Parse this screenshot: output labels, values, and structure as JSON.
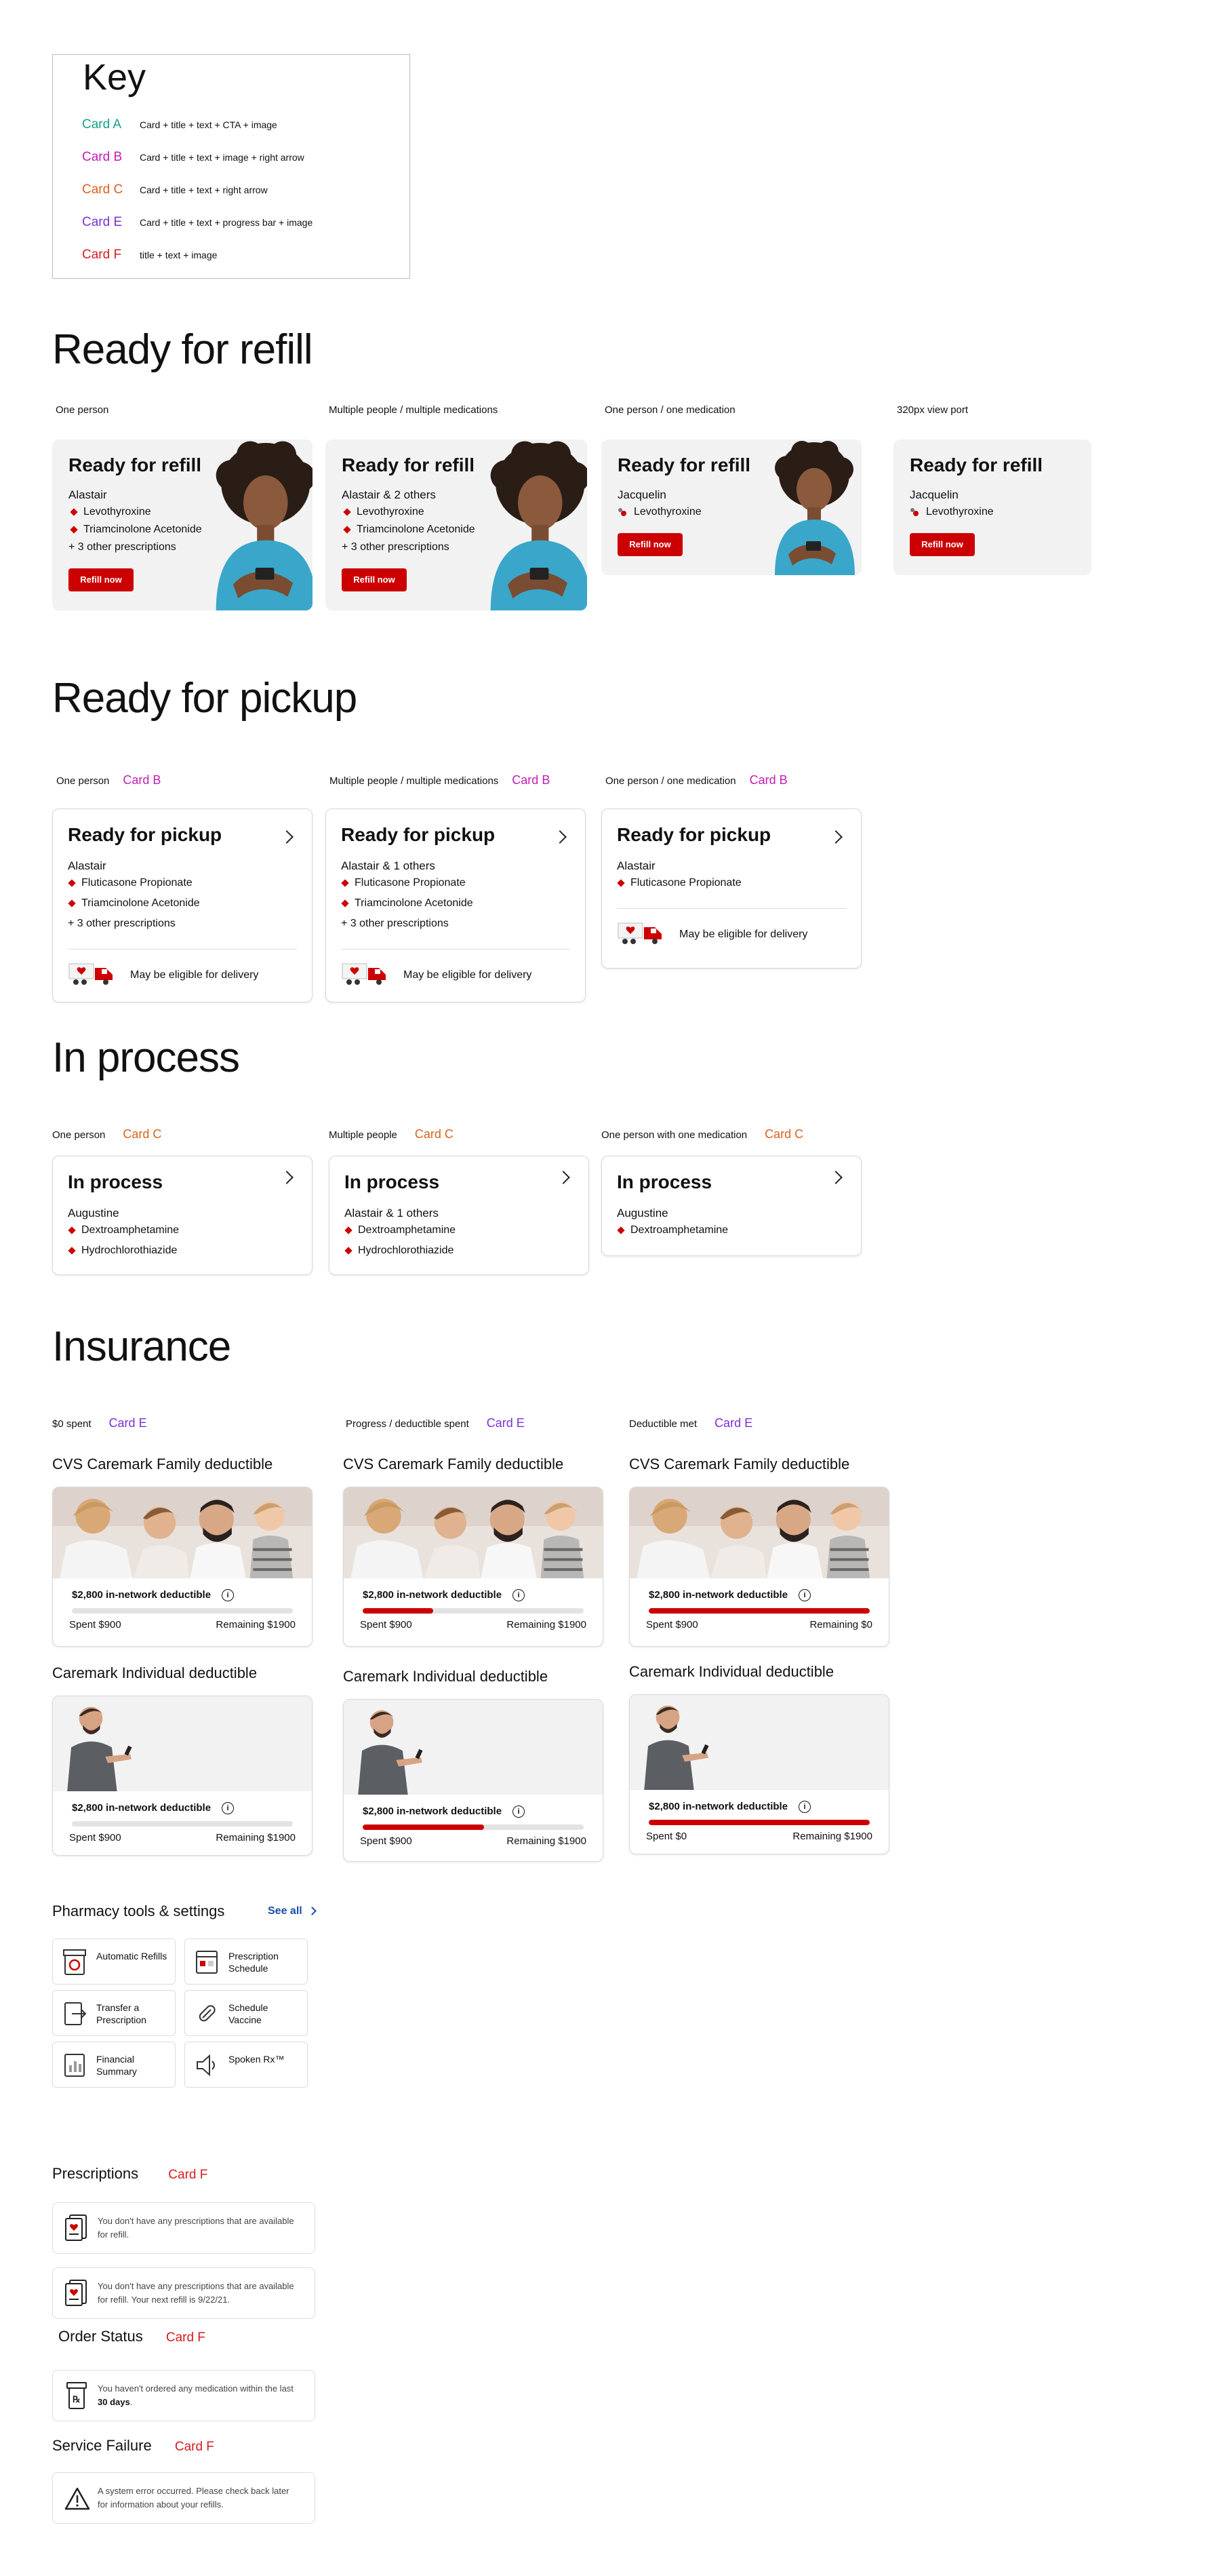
{
  "key": {
    "title": "Key",
    "items": [
      {
        "label": "Card A",
        "desc": "Card + title + text + CTA + image",
        "color": "#14a38b"
      },
      {
        "label": "Card B",
        "desc": "Card + title + text  + image + right arrow",
        "color": "#c21db5"
      },
      {
        "label": "Card C",
        "desc": "Card + title + text + right arrow",
        "color": "#d9621d"
      },
      {
        "label": "Card E",
        "desc": "Card + title + text  + progress bar + image",
        "color": "#7a30d6"
      },
      {
        "label": "Card F",
        "desc": "title + text  +  image",
        "color": "#d61c1c"
      }
    ]
  },
  "refill": {
    "title": "Ready for refill",
    "cards": [
      {
        "variant": "One person",
        "title": "Ready for refill",
        "person": "Alastair",
        "meds": [
          "Levothyroxine",
          "Triamcinolone Acetonide"
        ],
        "more": "+ 3 other prescriptions",
        "cta": "Refill now"
      },
      {
        "variant": "Multiple people / multiple medications",
        "title": "Ready for refill",
        "person": "Alastair & 2 others",
        "meds": [
          "Levothyroxine",
          "Triamcinolone Acetonide"
        ],
        "more": "+ 3 other prescriptions",
        "cta": "Refill now"
      },
      {
        "variant": "One person / one medication",
        "title": "Ready for refill",
        "person": "Jacquelin",
        "meds": [
          "Levothyroxine"
        ],
        "cta": "Refill now"
      },
      {
        "variant": "320px view port",
        "title": "Ready for refill",
        "person": "Jacquelin",
        "meds": [
          "Levothyroxine"
        ],
        "cta": "Refill now"
      }
    ]
  },
  "pickup": {
    "title": "Ready for pickup",
    "cards": [
      {
        "variant": "One person",
        "tag": "Card B",
        "title": "Ready for pickup",
        "person": "Alastair",
        "meds": [
          "Fluticasone Propionate",
          "Triamcinolone Acetonide"
        ],
        "more": "+ 3 other prescriptions",
        "delivery": "May be eligible for delivery"
      },
      {
        "variant": "Multiple people / multiple medications",
        "tag": "Card B",
        "title": "Ready for pickup",
        "person": "Alastair & 1 others",
        "meds": [
          "Fluticasone Propionate",
          "Triamcinolone Acetonide"
        ],
        "more": "+ 3 other prescriptions",
        "delivery": "May be eligible for delivery"
      },
      {
        "variant": "One person / one medication",
        "tag": "Card B",
        "title": "Ready for pickup",
        "person": "Alastair",
        "meds": [
          "Fluticasone Propionate"
        ],
        "delivery": "May be eligible for delivery"
      }
    ]
  },
  "inprocess": {
    "title": "In process",
    "cards": [
      {
        "variant": "One person",
        "tag": "Card C",
        "title": "In process",
        "person": "Augustine",
        "meds": [
          "Dextroamphetamine",
          "Hydrochlorothiazide"
        ]
      },
      {
        "variant": "Multiple people",
        "tag": "Card C",
        "title": "In process",
        "person": "Alastair & 1 others",
        "meds": [
          "Dextroamphetamine",
          "Hydrochlorothiazide"
        ]
      },
      {
        "variant": "One person with one medication",
        "tag": "Card C",
        "title": "In process",
        "person": "Augustine",
        "meds": [
          "Dextroamphetamine"
        ]
      }
    ]
  },
  "insurance": {
    "title": "Insurance",
    "columns": [
      {
        "variant": "$0 spent",
        "tag": "Card E",
        "family": {
          "heading": "CVS Caremark Family deductible",
          "label": "$2,800 in-network deductible",
          "spent": "Spent $900",
          "remaining": "Remaining $1900",
          "progress": 0
        },
        "individual": {
          "heading": "Caremark Individual deductible",
          "label": "$2,800 in-network deductible",
          "spent": "Spent $900",
          "remaining": "Remaining $1900",
          "progress": 0
        }
      },
      {
        "variant": "Progress / deductible spent",
        "tag": "Card E",
        "family": {
          "heading": "CVS Caremark Family deductible",
          "label": "$2,800 in-network deductible",
          "spent": "Spent $900",
          "remaining": "Remaining $1900",
          "progress": 0.32
        },
        "individual": {
          "heading": "Caremark Individual deductible",
          "label": "$2,800 in-network deductible",
          "spent": "Spent $900",
          "remaining": "Remaining $1900",
          "progress": 0.55
        }
      },
      {
        "variant": "Deductible met",
        "tag": "Card E",
        "family": {
          "heading": "CVS Caremark Family deductible",
          "label": "$2,800 in-network deductible",
          "spent": "Spent $900",
          "remaining": "Remaining $0",
          "progress": 1
        },
        "individual": {
          "heading": "Caremark Individual deductible",
          "label": "$2,800 in-network deductible",
          "spent": "Spent $0",
          "remaining": "Remaining $1900",
          "progress": 1
        }
      }
    ]
  },
  "tools": {
    "title": "Pharmacy tools & settings",
    "see_all": "See all",
    "items": [
      "Automatic Refills",
      "Prescription Schedule",
      "Transfer a Prescription",
      "Schedule Vaccine",
      "Financial Summary",
      "Spoken Rx™"
    ]
  },
  "prescriptions": {
    "title": "Prescriptions",
    "tag": "Card F",
    "msg1": "You don't have any prescriptions that are available for refill.",
    "msg2": "You don't have any prescriptions that are available for refill. Your next refill is 9/22/21."
  },
  "order_status": {
    "title": "Order Status",
    "tag": "Card F",
    "msg_pre": "You haven't ordered any medication within the last ",
    "msg_bold": "30 days",
    "msg_post": "."
  },
  "service_failure": {
    "title": "Service Failure",
    "tag": "Card F",
    "msg": "A system error occurred. Please check back later for information about your refills."
  },
  "colors": {
    "cvs_red": "#cc0000",
    "link_blue": "#1a4ea8"
  }
}
